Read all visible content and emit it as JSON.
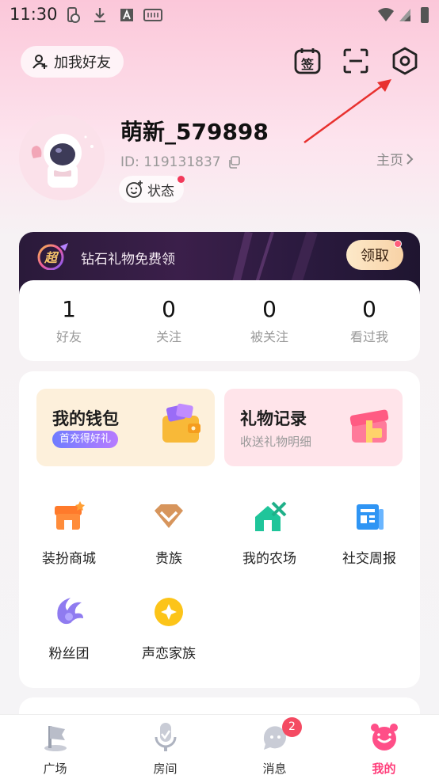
{
  "status_bar": {
    "time": "11:30"
  },
  "header": {
    "add_friend_label": "加我好友",
    "sign_icon_text": "签"
  },
  "profile": {
    "username": "萌新_579898",
    "user_id": "ID: 119131837",
    "status_label": "状态",
    "homepage_label": "主页"
  },
  "promo": {
    "badge_text": "超",
    "text": "钻石礼物免费领",
    "claim_label": "领取"
  },
  "stats": [
    {
      "value": "1",
      "label": "好友"
    },
    {
      "value": "0",
      "label": "关注"
    },
    {
      "value": "0",
      "label": "被关注"
    },
    {
      "value": "0",
      "label": "看过我"
    }
  ],
  "features": {
    "wallet": {
      "title": "我的钱包",
      "tag": "首充得好礼"
    },
    "gifts": {
      "title": "礼物记录",
      "subtitle": "收送礼物明细"
    }
  },
  "services": [
    {
      "label": "装扮商城",
      "icon": "shop-icon"
    },
    {
      "label": "贵族",
      "icon": "noble-icon"
    },
    {
      "label": "我的农场",
      "icon": "farm-icon"
    },
    {
      "label": "社交周报",
      "icon": "report-icon"
    },
    {
      "label": "粉丝团",
      "icon": "fan-club-icon"
    },
    {
      "label": "声恋家族",
      "icon": "family-icon"
    }
  ],
  "tabs": [
    {
      "label": "广场"
    },
    {
      "label": "房间"
    },
    {
      "label": "消息",
      "badge": "2"
    },
    {
      "label": "我的"
    }
  ],
  "colors": {
    "accent": "#ff3d7a",
    "badge": "#f44a62",
    "tag_gradient_start": "#6f7cff"
  }
}
